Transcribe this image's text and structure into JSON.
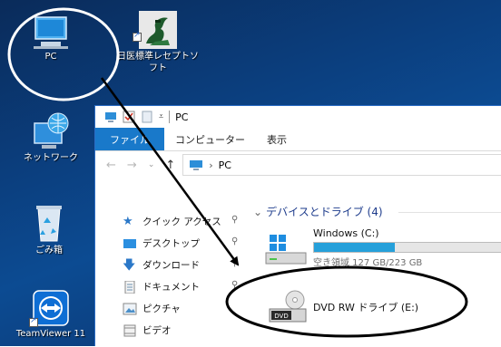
{
  "desktop": {
    "icons": [
      {
        "label": "PC",
        "icon": "pc-icon"
      },
      {
        "label": "日医標準レセプトソフト",
        "icon": "orca-receipt-software-icon"
      },
      {
        "label": "ネットワーク",
        "icon": "network-icon"
      },
      {
        "label": "ごみ箱",
        "icon": "recycle-bin-icon"
      },
      {
        "label": "TeamViewer 11",
        "icon": "teamviewer-icon"
      }
    ]
  },
  "explorer": {
    "title": "PC",
    "ribbon_tabs": [
      "ファイル",
      "コンピューター",
      "表示"
    ],
    "address": {
      "path": "PC"
    },
    "nav_pane": {
      "items": [
        {
          "label": "クイック アクセス",
          "icon": "star-icon"
        },
        {
          "label": "デスクトップ",
          "icon": "desktop-folder-icon"
        },
        {
          "label": "ダウンロード",
          "icon": "download-arrow-icon"
        },
        {
          "label": "ドキュメント",
          "icon": "document-icon"
        },
        {
          "label": "ピクチャ",
          "icon": "picture-icon"
        },
        {
          "label": "ビデオ",
          "icon": "video-icon"
        }
      ]
    },
    "content": {
      "group_header": "デバイスとドライブ (4)",
      "drives": [
        {
          "name": "Windows (C:)",
          "free_text": "空き領域 127 GB/223 GB",
          "used_fraction": 0.43,
          "icon": "windows-drive-icon"
        },
        {
          "name": "DVD RW ドライブ (E:)",
          "icon": "dvd-drive-icon",
          "badge": "DVD"
        }
      ]
    }
  },
  "colors": {
    "desktop_bg": "#0b3f7f",
    "ribbon_file_tab": "#1979ca",
    "usage_bar": "#26a0da",
    "annotation": "#000000"
  }
}
